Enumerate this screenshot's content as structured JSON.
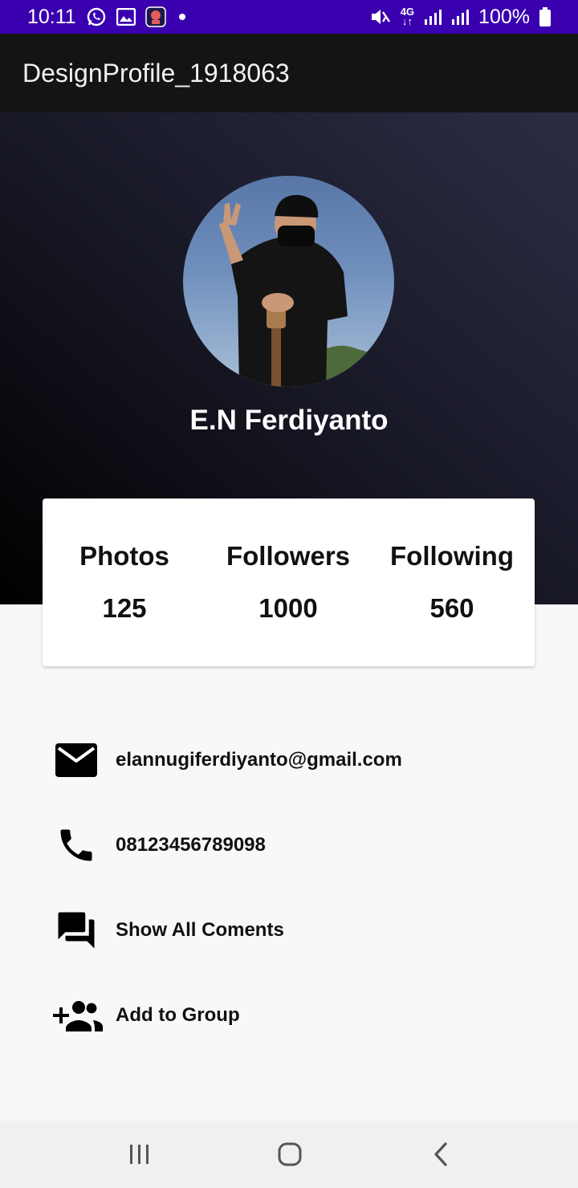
{
  "status_bar": {
    "time": "10:11",
    "battery": "100%",
    "network": "4G",
    "icons_left": [
      "whatsapp-icon",
      "gallery-icon",
      "app-icon"
    ],
    "icons_right": [
      "mute-icon",
      "network-4g-icon",
      "signal-icon",
      "signal-icon",
      "battery-icon"
    ]
  },
  "app_bar": {
    "title": "DesignProfile_1918063"
  },
  "profile": {
    "name": "E.N Ferdiyanto",
    "avatar": "profile-photo"
  },
  "stats": [
    {
      "label": "Photos",
      "value": "125"
    },
    {
      "label": "Followers",
      "value": "1000"
    },
    {
      "label": "Following",
      "value": "560"
    }
  ],
  "info": [
    {
      "icon": "email-icon",
      "text": "elannugiferdiyanto@gmail.com"
    },
    {
      "icon": "phone-icon",
      "text": "08123456789098"
    },
    {
      "icon": "comments-icon",
      "text": "Show All Coments"
    },
    {
      "icon": "add-group-icon",
      "text": "Add to Group"
    }
  ],
  "nav": [
    "recent-apps-icon",
    "home-icon",
    "back-icon"
  ],
  "colors": {
    "status_bar": "#3a00b0",
    "app_bar": "#141414",
    "header_dark": "#000000",
    "header_light": "#2b2d45",
    "card": "#ffffff",
    "background": "#f8f8f8"
  }
}
